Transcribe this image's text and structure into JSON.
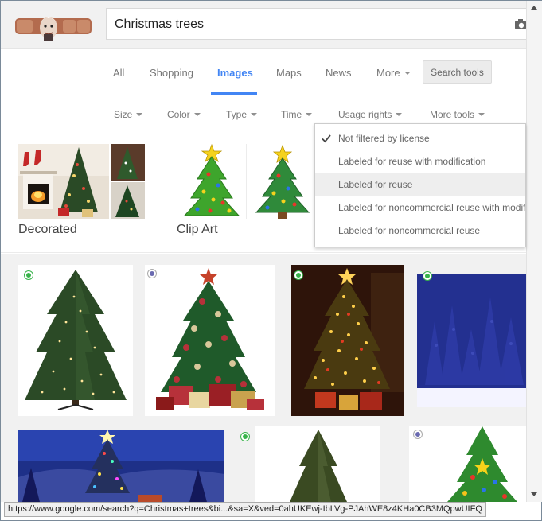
{
  "search": {
    "query": "Christmas trees"
  },
  "nav": {
    "tabs": [
      {
        "label": "All"
      },
      {
        "label": "Shopping"
      },
      {
        "label": "Images"
      },
      {
        "label": "Maps"
      },
      {
        "label": "News"
      },
      {
        "label": "More"
      }
    ],
    "search_tools": "Search tools"
  },
  "tools": {
    "items": [
      {
        "label": "Size"
      },
      {
        "label": "Color"
      },
      {
        "label": "Type"
      },
      {
        "label": "Time"
      },
      {
        "label": "Usage rights"
      },
      {
        "label": "More tools"
      }
    ]
  },
  "usage_menu": {
    "items": [
      {
        "label": "Not filtered by license"
      },
      {
        "label": "Labeled for reuse with modification"
      },
      {
        "label": "Labeled for reuse"
      },
      {
        "label": "Labeled for noncommercial reuse with modification"
      },
      {
        "label": "Labeled for noncommercial reuse"
      }
    ]
  },
  "related": [
    {
      "label": "Decorated"
    },
    {
      "label": "Clip Art"
    }
  ],
  "status": {
    "url": "https://www.google.com/search?q=Christmas+trees&bi...&sa=X&ved=0ahUKEwj-IbLVg-PJAhWE8z4KHa0CB3MQpwUIFQ"
  },
  "colors": {
    "accent": "#4285f4",
    "license_green": "#38b34a",
    "license_unknown": "#6a6ab0"
  }
}
